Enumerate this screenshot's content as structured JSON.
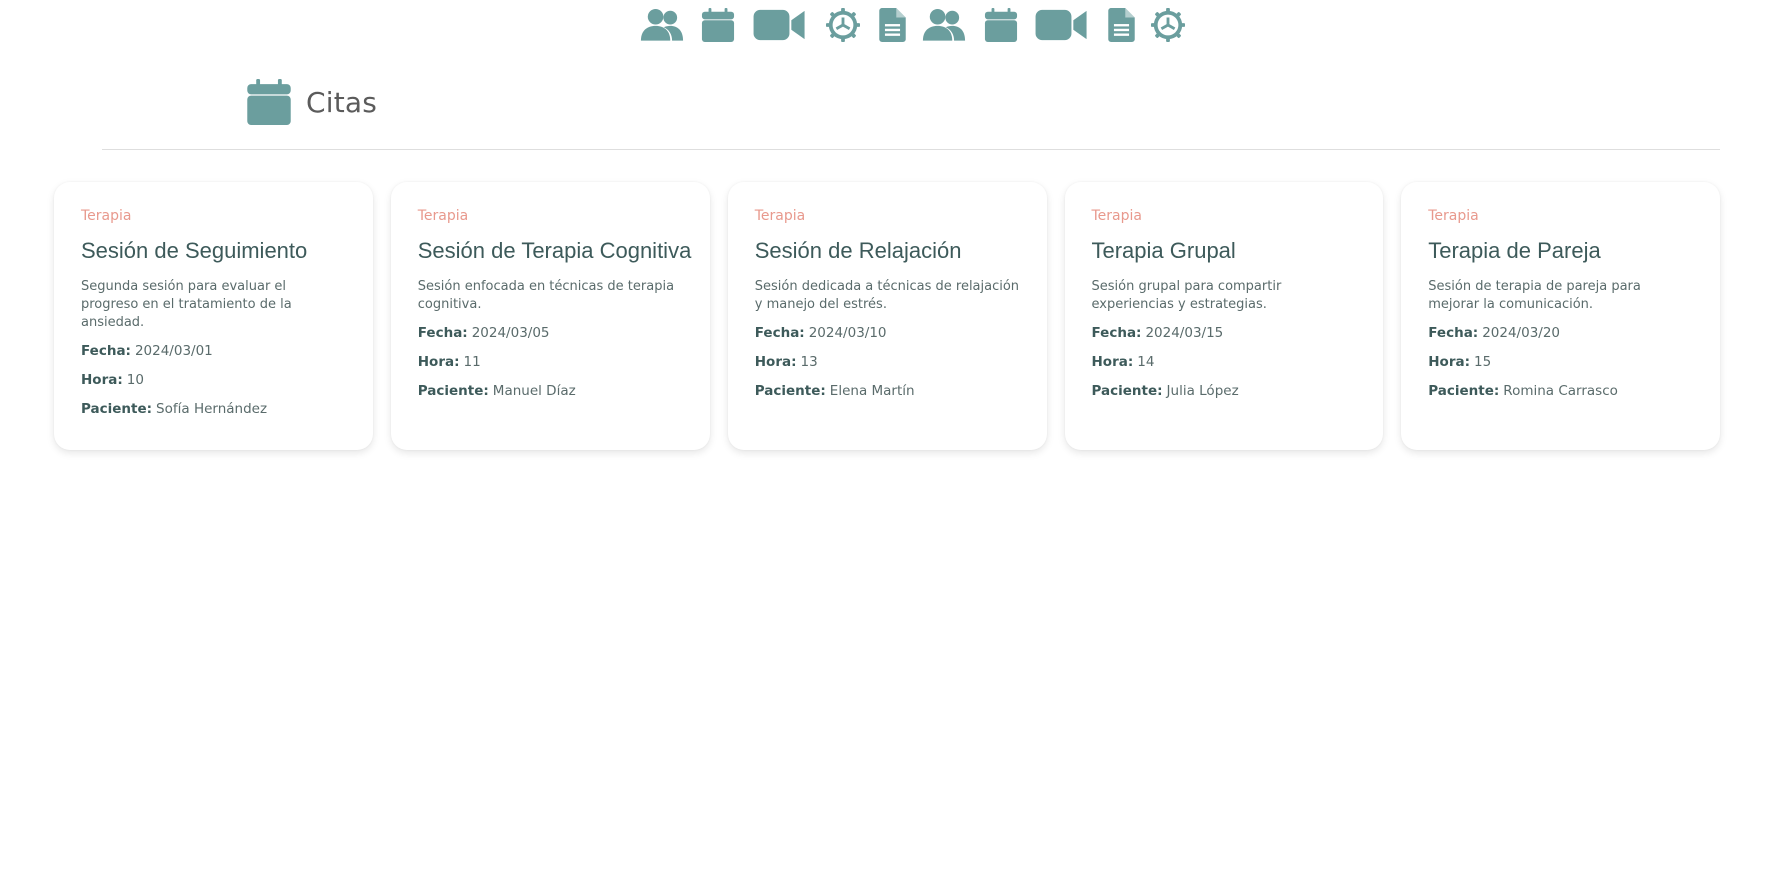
{
  "nav": {
    "icons": [
      {
        "name": "users-icon"
      },
      {
        "name": "calendar-icon"
      },
      {
        "name": "video-icon"
      },
      {
        "name": "gear-icon"
      },
      {
        "name": "document-icon"
      },
      {
        "name": "users-icon"
      },
      {
        "name": "calendar-icon"
      },
      {
        "name": "video-icon"
      },
      {
        "name": "document-icon"
      },
      {
        "name": "gear-icon"
      }
    ],
    "icon_color": "#6b9e9e"
  },
  "header": {
    "icon": "calendar-icon",
    "title": "Citas"
  },
  "labels": {
    "fecha": "Fecha:",
    "hora": "Hora:",
    "paciente": "Paciente:"
  },
  "colors": {
    "category": "#e8998d",
    "title": "#3d5a5a",
    "icon": "#6b9e9e"
  },
  "appointments": [
    {
      "category": "Terapia",
      "title": "Sesión de Seguimiento",
      "description": "Segunda sesión para evaluar el progreso en el tratamiento de la ansiedad.",
      "fecha": "2024/03/01",
      "hora": "10",
      "paciente": "Sofía Hernández"
    },
    {
      "category": "Terapia",
      "title": "Sesión de Terapia Cognitiva",
      "description": "Sesión enfocada en técnicas de terapia cognitiva.",
      "fecha": "2024/03/05",
      "hora": "11",
      "paciente": "Manuel Díaz"
    },
    {
      "category": "Terapia",
      "title": "Sesión de Relajación",
      "description": "Sesión dedicada a técnicas de relajación y manejo del estrés.",
      "fecha": "2024/03/10",
      "hora": "13",
      "paciente": "Elena Martín"
    },
    {
      "category": "Terapia",
      "title": "Terapia Grupal",
      "description": "Sesión grupal para compartir experiencias y estrategias.",
      "fecha": "2024/03/15",
      "hora": "14",
      "paciente": "Julia López"
    },
    {
      "category": "Terapia",
      "title": "Terapia de Pareja",
      "description": "Sesión de terapia de pareja para mejorar la comunicación.",
      "fecha": "2024/03/20",
      "hora": "15",
      "paciente": "Romina Carrasco"
    }
  ]
}
